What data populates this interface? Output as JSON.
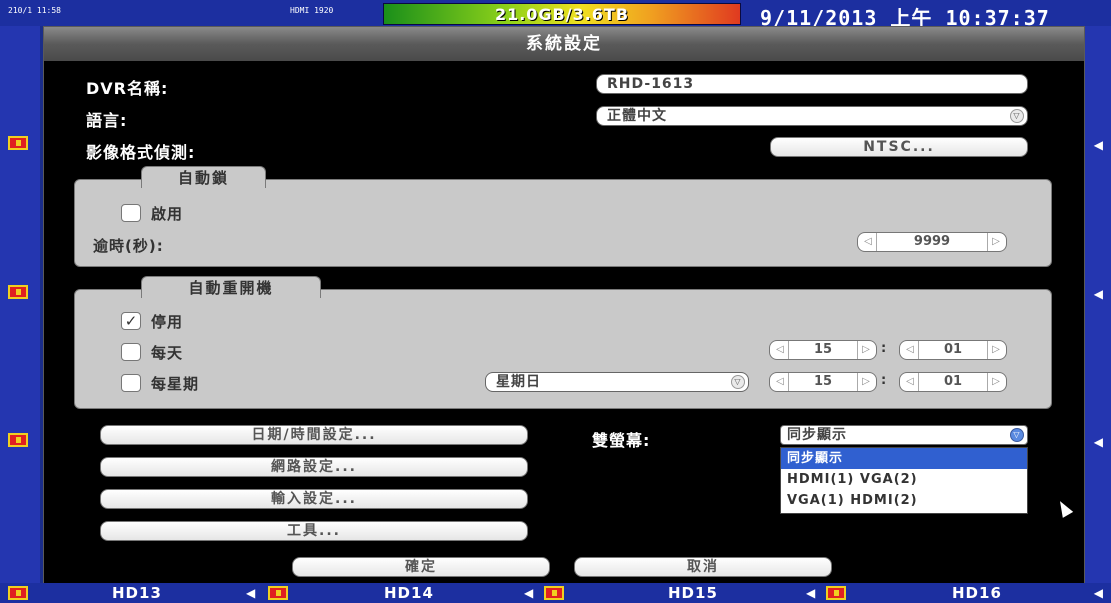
{
  "topbar": {
    "left_text": "210/1 11:58",
    "mid_text": "HDMI 1920",
    "storage": "21.0GB/3.6TB",
    "clock": "9/11/2013 上午 10:37:37"
  },
  "dialog": {
    "title": "系統設定",
    "dvr_name_label": "DVR名稱:",
    "dvr_name_value": "RHD-1613",
    "language_label": "語言:",
    "language_value": "正體中文",
    "video_format_label": "影像格式偵測:",
    "video_format_button": "NTSC...",
    "auto_lock": {
      "title": "自動鎖",
      "enable_label": "啟用",
      "enable_checked": false,
      "timeout_label": "逾時(秒):",
      "timeout_value": "9999"
    },
    "auto_reboot": {
      "title": "自動重開機",
      "options": [
        {
          "label": "停用",
          "checked": true
        },
        {
          "label": "每天",
          "checked": false
        },
        {
          "label": "每星期",
          "checked": false
        }
      ],
      "weekday_value": "星期日",
      "daily_hour": "15",
      "daily_minute": "01",
      "weekly_hour": "15",
      "weekly_minute": "01",
      "sep": ":"
    },
    "buttons": {
      "datetime": "日期/時間設定...",
      "network": "網路設定...",
      "input": "輸入設定...",
      "tools": "工具..."
    },
    "dual_screen_label": "雙螢幕:",
    "dual_screen_value": "同步顯示",
    "dual_screen_options": [
      "同步顯示",
      "HDMI(1) VGA(2)",
      "VGA(1) HDMI(2)"
    ],
    "ok_button": "確定",
    "cancel_button": "取消"
  },
  "bottombar": {
    "channels": [
      "HD13",
      "HD14",
      "HD15",
      "HD16"
    ]
  },
  "colors": {
    "background": "#1a2d8a",
    "dialog_bg": "#000000",
    "group_bg": "#c9c9c9",
    "highlight": "#3060d0"
  }
}
